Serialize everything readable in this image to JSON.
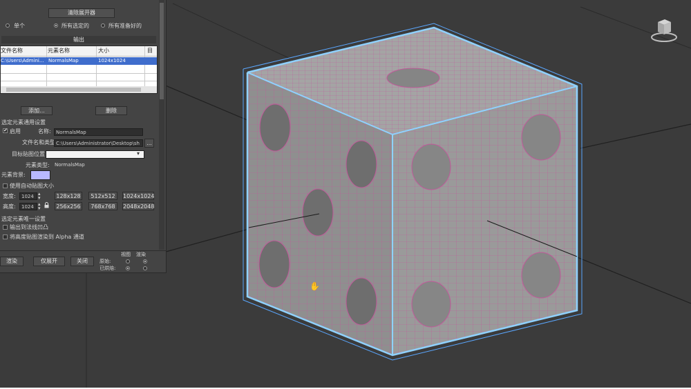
{
  "panel": {
    "clear_unwrapper_button": "清除展开器",
    "scope_options": [
      {
        "label": "单个",
        "selected": false
      },
      {
        "label": "所有选定的",
        "selected": true
      },
      {
        "label": "所有准备好的",
        "selected": false
      }
    ],
    "output_section_title": "输出",
    "table": {
      "headers": [
        "文件名称",
        "元素名称",
        "大小",
        "目标"
      ],
      "rows": [
        [
          "C:\\Users\\Admini...",
          "NormalsMap",
          "1024x1024",
          ""
        ]
      ]
    },
    "add_button": "添加...",
    "delete_button": "删除",
    "common_settings_title": "选定元素通用设置",
    "enable_label": "启用",
    "enable_checked": true,
    "name_label": "名称:",
    "name_value": "NormalsMap",
    "file_label": "文件名和类型:",
    "file_value": "C:\\Users\\Administrator\\Desktop\\sh",
    "browse_button": "...",
    "target_label": "目标贴图位置:",
    "target_value": "",
    "element_type_label": "元素类型:",
    "element_type_value": "NormalsMap",
    "element_bg_label": "元素背景:",
    "element_bg_color": "#b8b8ff",
    "auto_size_label": "使用自动贴图大小",
    "width_label": "宽度:",
    "width_value": "1024",
    "height_label": "高度:",
    "height_value": "1024",
    "size_presets": [
      "128x128",
      "512x512",
      "1024x1024",
      "256x256",
      "768x768",
      "2048x2048"
    ],
    "unique_settings_title": "选定元素唯一设置",
    "output_bump_label": "输出到法线凹凸",
    "alpha_label": "将高度贴图渲染到 Alpha 通道",
    "render_button": "渲染",
    "unwrap_only_button": "仅展开",
    "close_button": "关闭",
    "view_label": "视图",
    "render_label": "渲染",
    "original_label": "原始:",
    "baked_label": "已烘焙:"
  },
  "colors": {
    "viewport_bg": "#3b3b3b",
    "mesh_face": "#959595",
    "wire": "#c05a9a",
    "bounding": "#8fd1ff"
  },
  "viewport": {
    "view_cube_icon": "view-cube-icon",
    "cursor_icon": "hand-cursor-icon"
  }
}
